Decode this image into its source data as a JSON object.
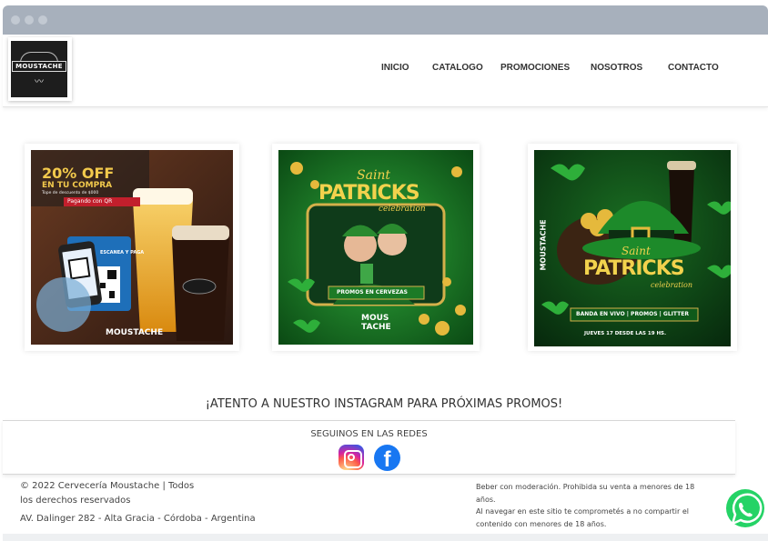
{
  "site": {
    "logo_text": "MOUSTACHE",
    "nav": [
      "INICIO",
      "CATALOGO",
      "PROMOCIONES",
      "NOSOTROS",
      "CONTACTO"
    ]
  },
  "promos": [
    {
      "headline": "20% OFF",
      "subline": "EN TU COMPRA",
      "note": "Tope de descuento de $000",
      "pay": "Pagando con QR",
      "qr_label": "ESCANEA Y PAGA",
      "brand": "MOUSTACHE"
    },
    {
      "title1": "Saint",
      "title2": "PATRICKS",
      "title3": "celebration",
      "ribbon": "PROMOS EN CERVEZAS",
      "brand1": "MOUS",
      "brand2": "TACHE"
    },
    {
      "title1": "Saint",
      "title2": "PATRICKS",
      "title3": "celebration",
      "side": "MOUSTACHE",
      "banner": "BANDA EN VIVO | PROMOS | GLITTER",
      "date": "JUEVES 17 DESDE LAS 19 HS."
    }
  ],
  "instagram_heading": "¡ATENTO A NUESTRO INSTAGRAM PARA PRÓXIMAS PROMOS!",
  "social": {
    "title": "SEGUINOS EN LAS REDES",
    "fb_glyph": "f"
  },
  "footer": {
    "copyright_line1": "© 2022 Cervecería Moustache | Todos",
    "copyright_line2": "los derechos reservados",
    "address": "AV. Dalinger 282 - Alta Gracia - Córdoba - Argentina",
    "disclaimer1": "Beber con moderación. Prohibida su venta a menores de 18 años.",
    "disclaimer2": "Al navegar en este sitio te comprometés a no compartir el contenido con menores de 18 años."
  },
  "colors": {
    "browser_bar": "#a7b0bc",
    "promo_green": "#1f8a2a",
    "whatsapp": "#25d366",
    "facebook": "#1877f2"
  }
}
